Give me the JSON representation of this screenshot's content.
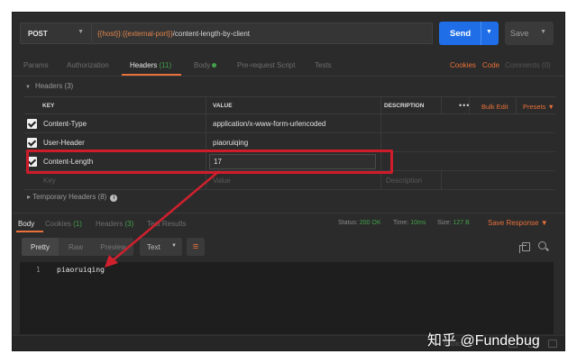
{
  "request": {
    "method": "POST",
    "url_var": "{{host}}:{{external-port}}",
    "url_path": "/content-length-by-client",
    "send_label": "Send",
    "save_label": "Save"
  },
  "tabs": [
    {
      "label": "Params"
    },
    {
      "label": "Authorization"
    },
    {
      "label": "Headers",
      "count": "(11)"
    },
    {
      "label": "Body"
    },
    {
      "label": "Pre-request Script"
    },
    {
      "label": "Tests"
    }
  ],
  "tab_links": {
    "cookies": "Cookies",
    "code": "Code",
    "comments": "Comments (0)"
  },
  "headers_section": {
    "title": "Headers (3)"
  },
  "table": {
    "columns": {
      "key": "KEY",
      "value": "VALUE",
      "description": "DESCRIPTION"
    },
    "bulk_edit": "Bulk Edit",
    "presets": "Presets",
    "rows": [
      {
        "key": "Content-Type",
        "value": "application/x-www-form-urlencoded"
      },
      {
        "key": "User-Header",
        "value": "piaoruiqing"
      },
      {
        "key": "Content-Length",
        "value": "17"
      }
    ],
    "placeholder": {
      "key": "Key",
      "value": "Value",
      "description": "Description"
    }
  },
  "temporary_headers": "Temporary Headers (8)",
  "response_tabs": [
    {
      "label": "Body"
    },
    {
      "label": "Cookies",
      "count": "(1)"
    },
    {
      "label": "Headers",
      "count": "(3)"
    },
    {
      "label": "Test Results"
    }
  ],
  "status": {
    "status_label": "Status:",
    "status_value": "200 OK",
    "time_label": "Time:",
    "time_value": "10ms",
    "size_label": "Size:",
    "size_value": "127 B",
    "save_response": "Save Response"
  },
  "response_toolbar": {
    "pretty": "Pretty",
    "raw": "Raw",
    "preview": "Preview",
    "format": "Text"
  },
  "code": {
    "line": "1",
    "text": "piaoruiqing"
  },
  "bottom_bar": {
    "bootcamp": "Bootcamp"
  },
  "watermark": "知乎 @Fundebug",
  "colors": {
    "accent": "#e8703a",
    "send": "#1f6ee8",
    "highlight": "#cf1c2b",
    "success": "#42a14a"
  }
}
